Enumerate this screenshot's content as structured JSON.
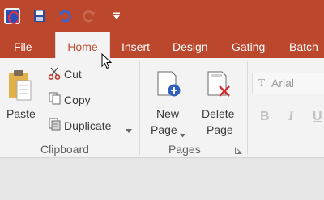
{
  "quick_access": {
    "items": [
      "app-icon",
      "save-icon",
      "undo-icon",
      "redo-icon",
      "customize-dropdown-icon"
    ]
  },
  "tabs": {
    "file": "File",
    "home": "Home",
    "insert": "Insert",
    "design": "Design",
    "gating": "Gating",
    "batch": "Batch",
    "active": "Home"
  },
  "clipboard": {
    "paste": "Paste",
    "cut": "Cut",
    "copy": "Copy",
    "duplicate": "Duplicate",
    "group_label": "Clipboard"
  },
  "pages": {
    "new_page_line1": "New",
    "new_page_line2": "Page",
    "delete_page_line1": "Delete",
    "delete_page_line2": "Page",
    "group_label": "Pages"
  },
  "font": {
    "family_value": "Arial",
    "bold": "B",
    "italic": "I",
    "underline": "U"
  },
  "colors": {
    "title_bar": "#bb472c",
    "active_tab_text": "#c0492c",
    "ribbon_bg": "#f3f3f3",
    "workspace_bg": "#e6e6e6"
  }
}
